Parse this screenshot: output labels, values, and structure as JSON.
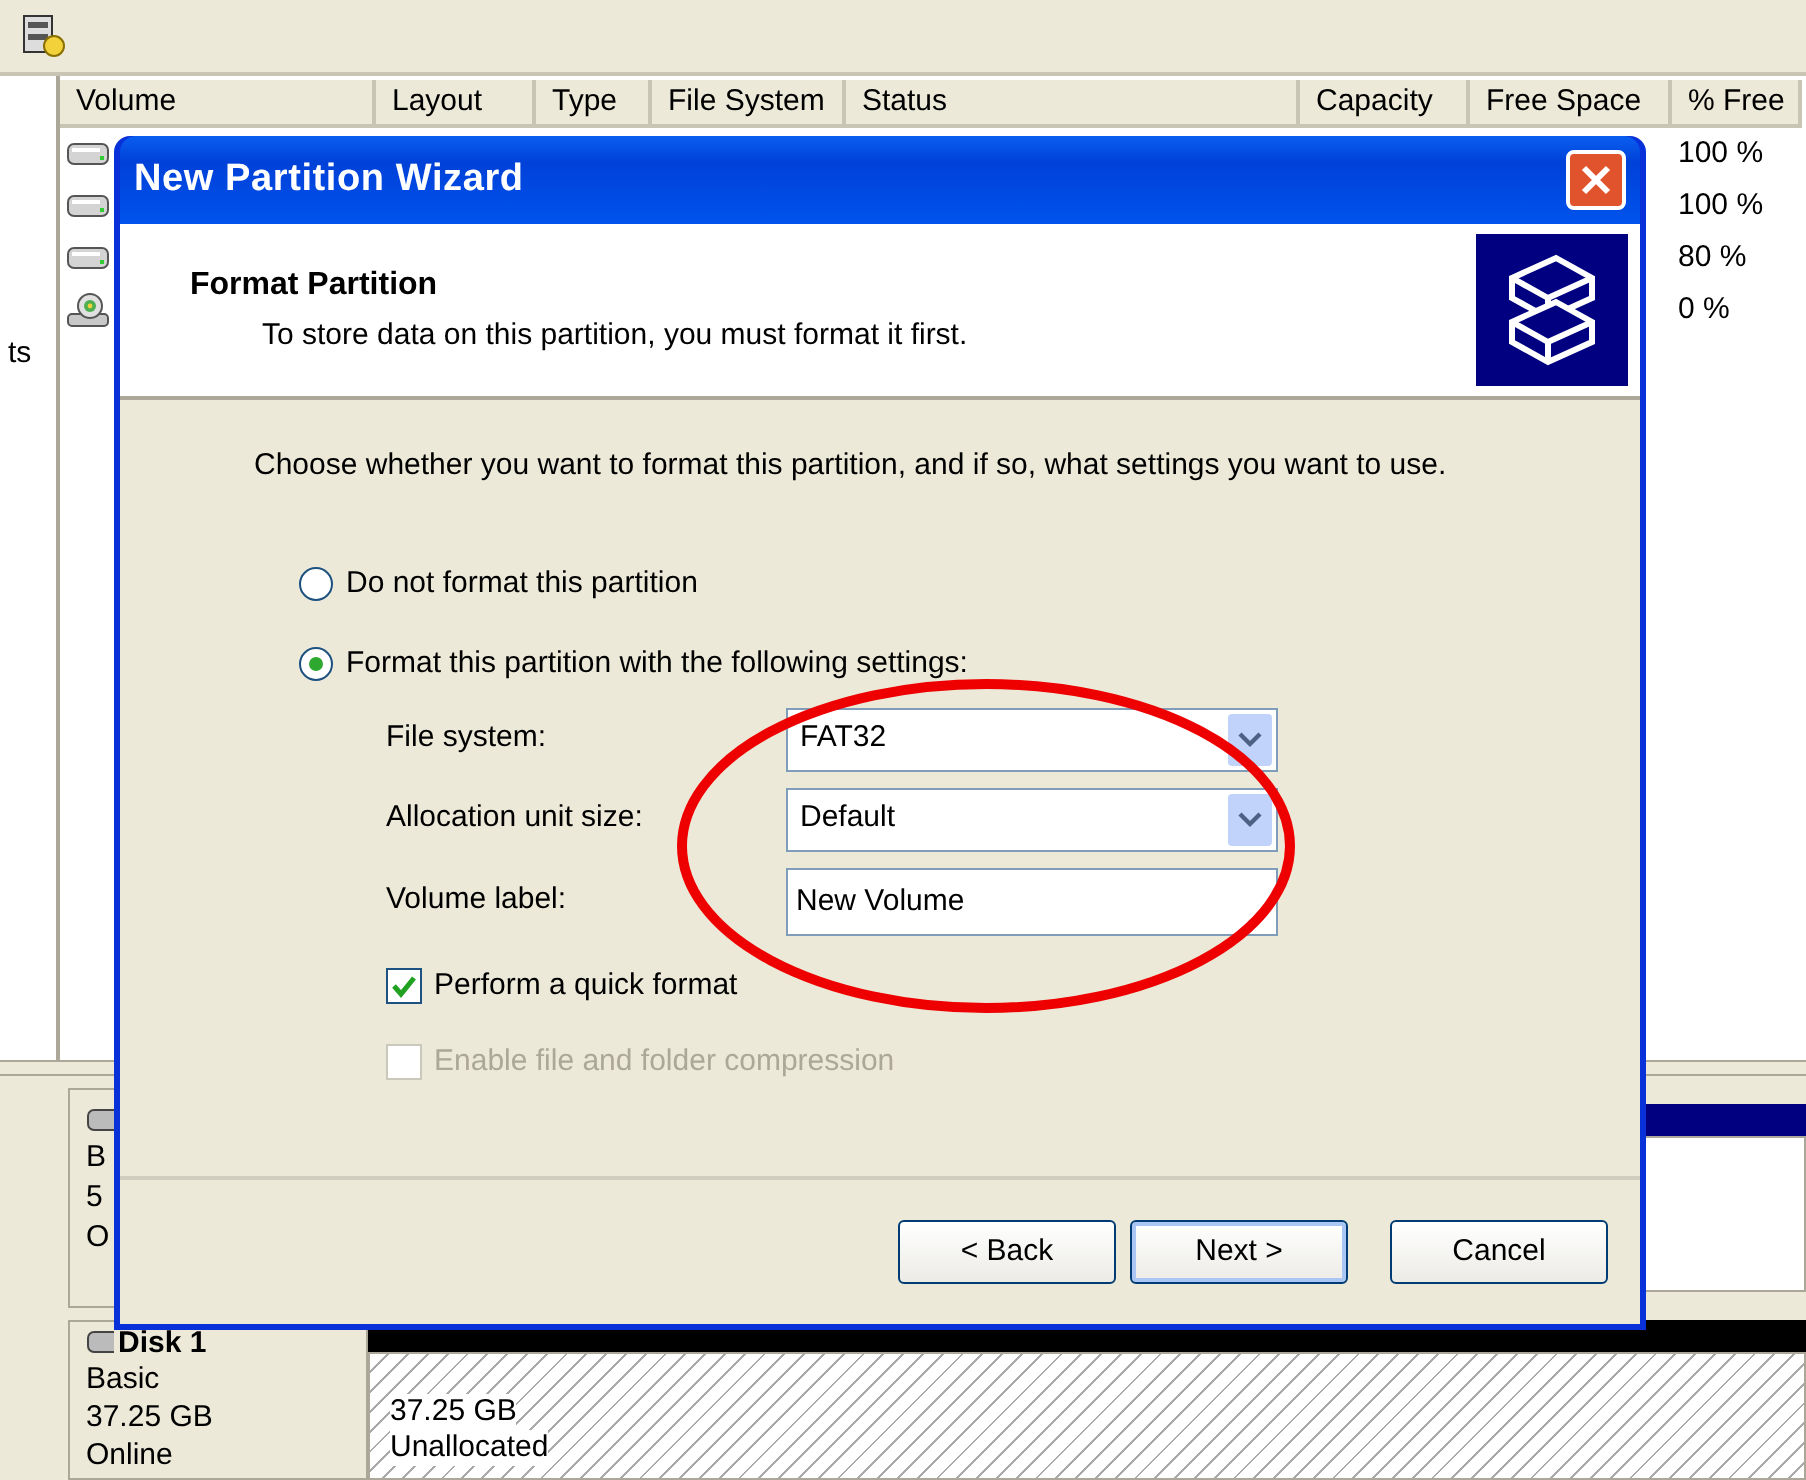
{
  "volume_list": {
    "columns": [
      "Volume",
      "Layout",
      "Type",
      "File System",
      "Status",
      "Capacity",
      "Free Space",
      "% Free"
    ],
    "rows": [
      {
        "kind": "disk",
        "percent_free": "100 %"
      },
      {
        "kind": "disk",
        "percent_free": "100 %"
      },
      {
        "kind": "disk",
        "percent_free": "80 %"
      },
      {
        "kind": "cd",
        "percent_free": "0 %"
      }
    ]
  },
  "left_pane": {
    "text": "ts"
  },
  "disks": [
    {
      "lines": [
        "B",
        "5",
        "O"
      ]
    },
    {
      "name": "Disk 1",
      "lines": [
        "Basic",
        "37.25 GB",
        "Online"
      ],
      "partition": {
        "size": "37.25 GB",
        "status": "Unallocated"
      }
    }
  ],
  "dialog": {
    "title": "New Partition Wizard",
    "header": {
      "title": "Format Partition",
      "subtitle": "To store data on this partition, you must format it first."
    },
    "instruction": "Choose whether you want to format this partition, and if so, what settings you want to use.",
    "options": [
      {
        "label": "Do not format this partition",
        "selected": false
      },
      {
        "label": "Format this partition with the following settings:",
        "selected": true
      }
    ],
    "settings": [
      {
        "kind": "dropdown",
        "label": "File system:",
        "value": "FAT32"
      },
      {
        "kind": "dropdown",
        "label": "Allocation unit size:",
        "value": "Default"
      },
      {
        "kind": "text",
        "label": "Volume label:",
        "value": "New Volume"
      }
    ],
    "checkboxes": [
      {
        "label": "Perform a quick format",
        "checked": true,
        "disabled": false
      },
      {
        "label": "Enable file and folder compression",
        "checked": false,
        "disabled": true
      }
    ],
    "buttons": [
      {
        "label": "< Back",
        "default": false
      },
      {
        "label": "Next >",
        "default": true
      },
      {
        "label": "Cancel",
        "default": false
      }
    ]
  }
}
